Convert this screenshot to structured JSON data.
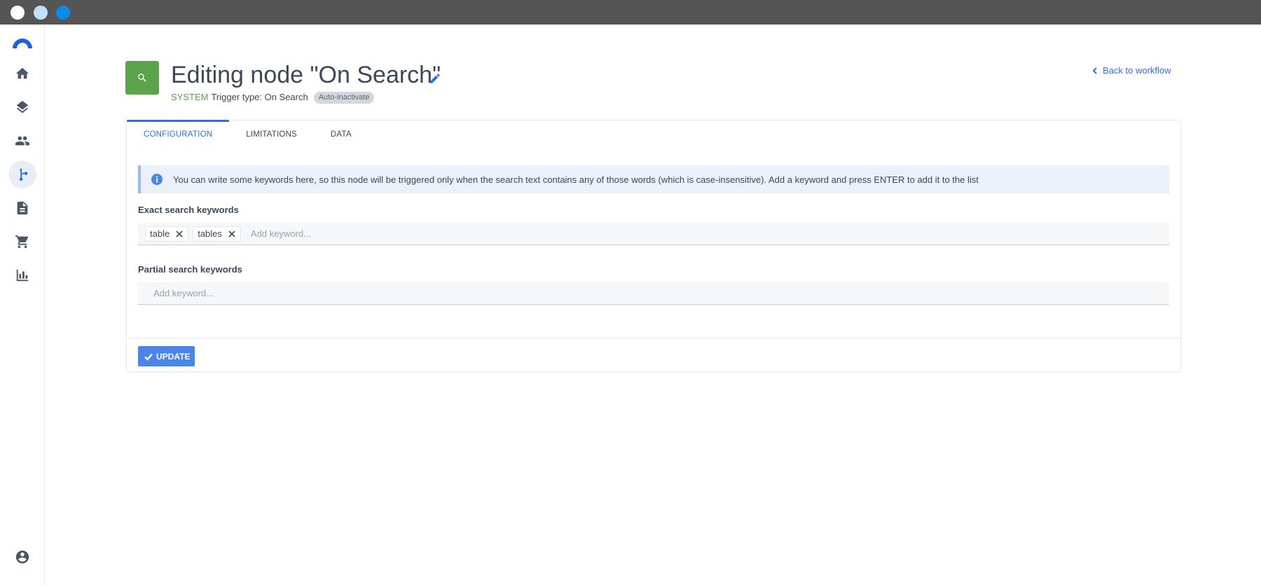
{
  "window": {
    "controls": [
      "close",
      "minimize",
      "maximize"
    ]
  },
  "sidebar": {
    "items": [
      {
        "name": "home",
        "icon": "home-icon"
      },
      {
        "name": "layers",
        "icon": "layers-icon"
      },
      {
        "name": "users",
        "icon": "people-icon"
      },
      {
        "name": "workflows",
        "icon": "workflow-icon",
        "active": true
      },
      {
        "name": "documents",
        "icon": "document-icon"
      },
      {
        "name": "shop",
        "icon": "cart-icon"
      },
      {
        "name": "analytics",
        "icon": "bar-chart-icon"
      },
      {
        "name": "account",
        "icon": "account-circle-icon"
      }
    ],
    "accent_color": "#2f6fde"
  },
  "header": {
    "title": "Editing node \"On Search\"",
    "system_label": "SYSTEM",
    "trigger_type": "Trigger type: On Search",
    "badge": "Auto-inactivate",
    "back_link": "Back to workflow",
    "node_icon_color": "#5aa34b"
  },
  "tabs": [
    {
      "label": "CONFIGURATION",
      "active": true
    },
    {
      "label": "LIMITATIONS",
      "active": false
    },
    {
      "label": "DATA",
      "active": false
    }
  ],
  "info": {
    "text": "You can write some keywords here, so this node will be triggered only when the search text contains any of those words (which is case-insensitive). Add a keyword and press ENTER to add it to the list"
  },
  "exact": {
    "label": "Exact search keywords",
    "chips": [
      "table",
      "tables"
    ],
    "placeholder": "Add keyword..."
  },
  "partial": {
    "label": "Partial search keywords",
    "chips": [],
    "placeholder": "Add keyword..."
  },
  "footer": {
    "update_label": "UPDATE"
  }
}
